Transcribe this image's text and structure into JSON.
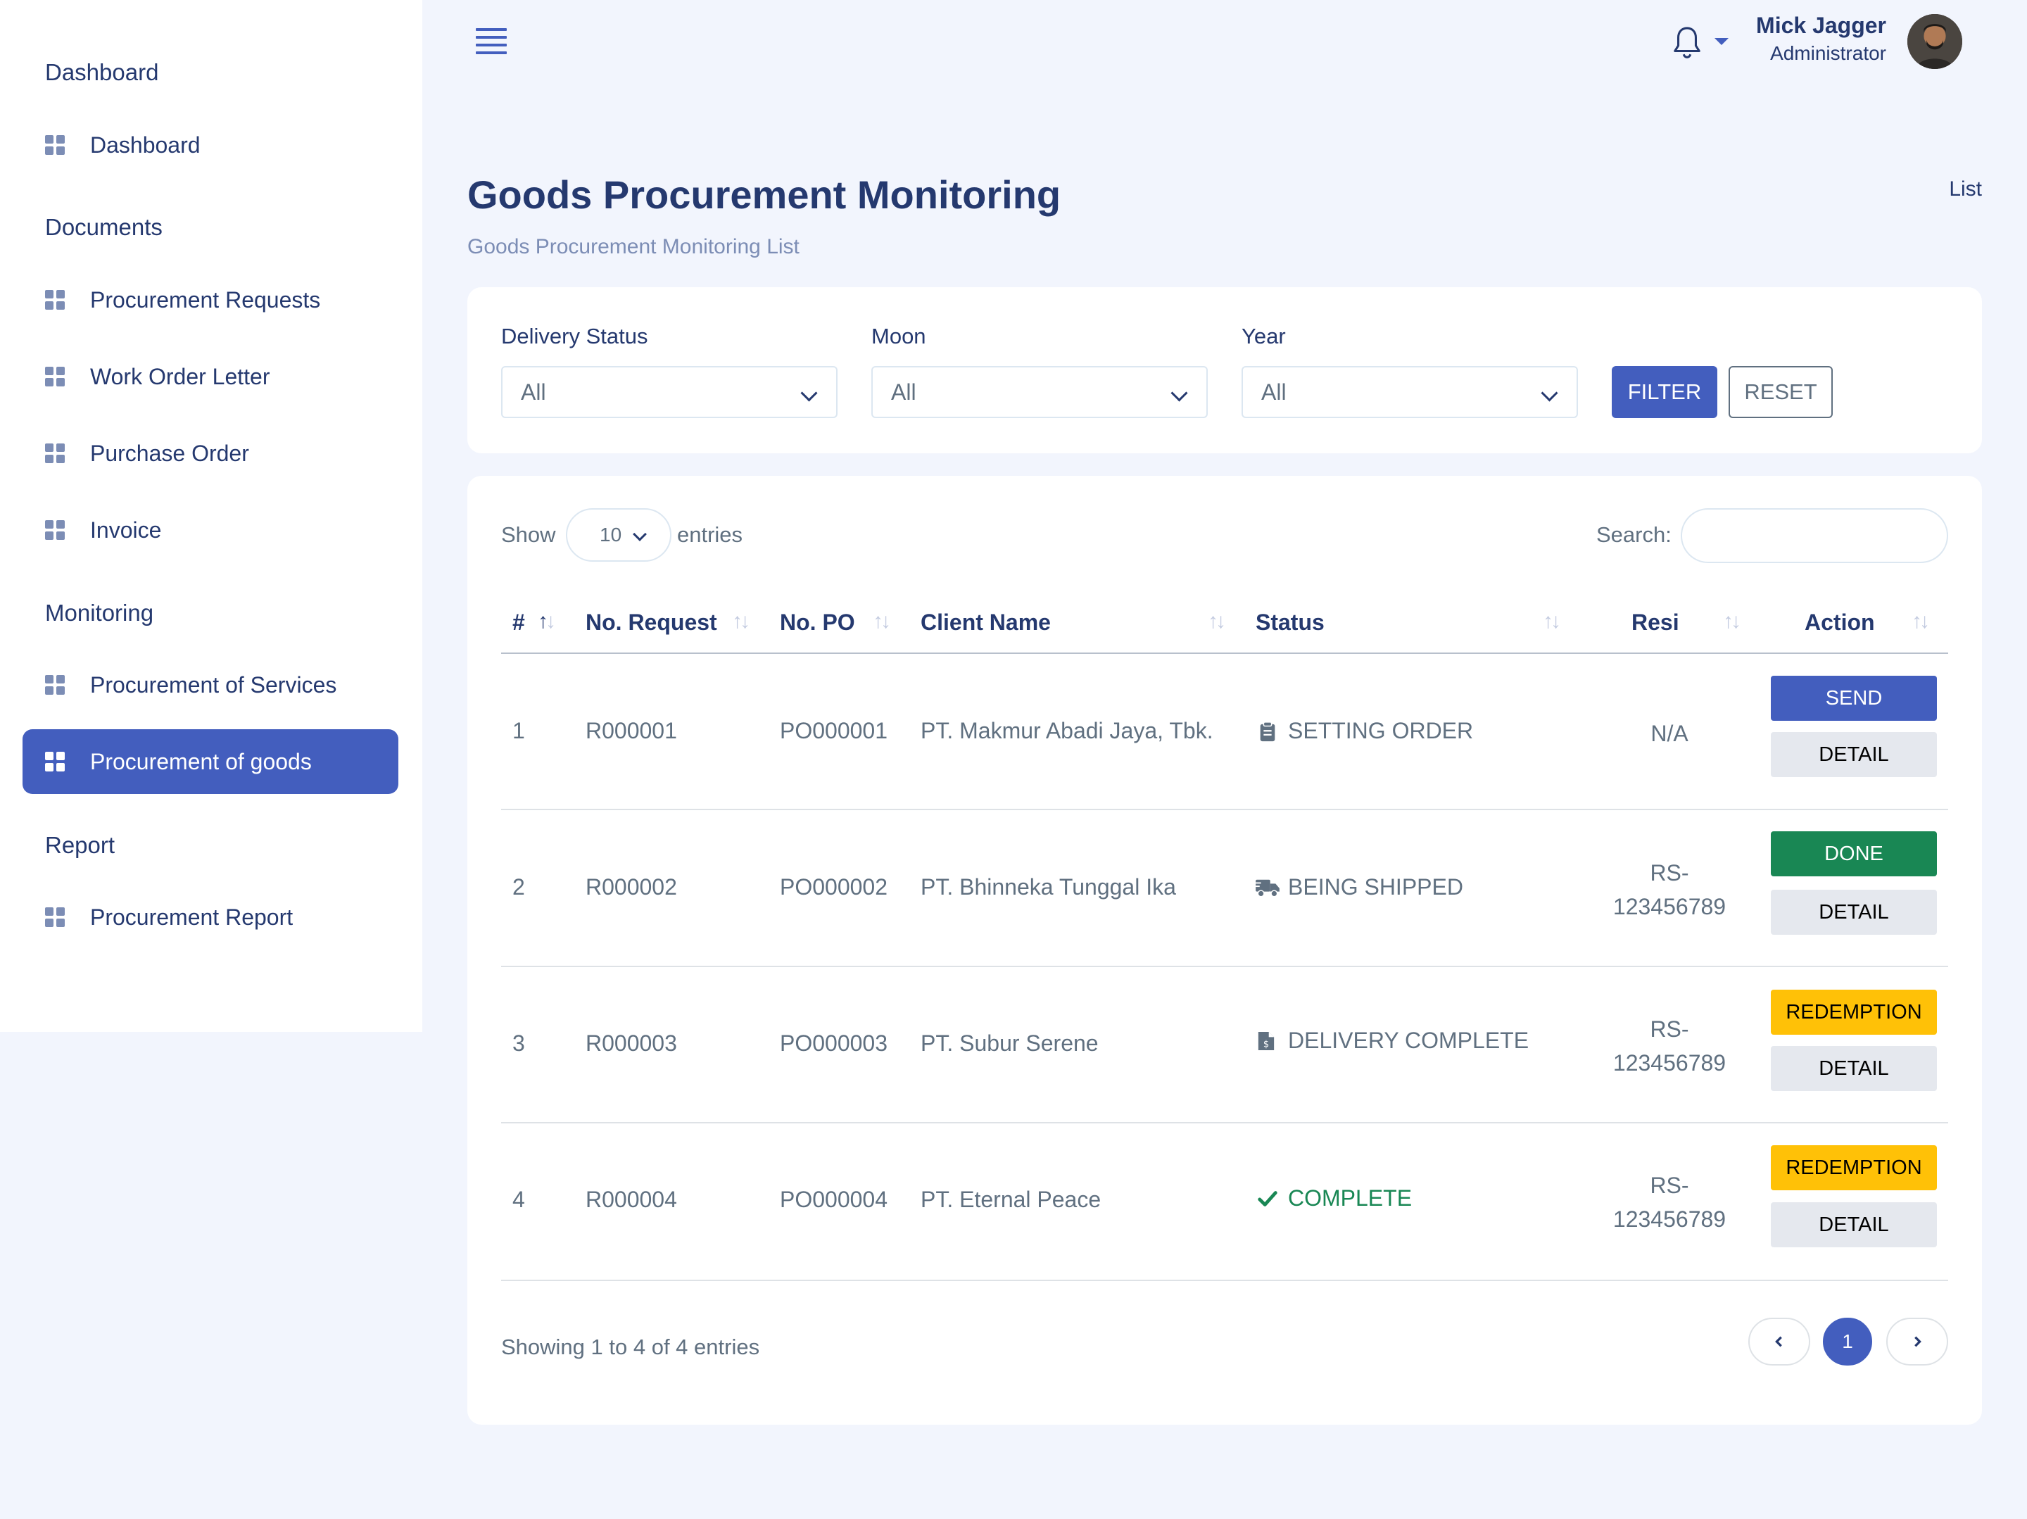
{
  "sidebar": {
    "sections": [
      {
        "title": "Dashboard",
        "items": [
          "Dashboard"
        ]
      },
      {
        "title": "Documents",
        "items": [
          "Procurement Requests",
          "Work Order Letter",
          "Purchase Order",
          "Invoice"
        ]
      },
      {
        "title": "Monitoring",
        "items": [
          "Procurement of Services",
          "Procurement of goods"
        ]
      },
      {
        "title": "Report",
        "items": [
          "Procurement Report"
        ]
      }
    ],
    "active_item": "Procurement of goods"
  },
  "header": {
    "user_name": "Mick Jagger",
    "user_role": "Administrator"
  },
  "page": {
    "title": "Goods Procurement Monitoring",
    "subtitle": "Goods Procurement Monitoring List",
    "breadcrumb": "List"
  },
  "filters": {
    "delivery_status": {
      "label": "Delivery Status",
      "value": "All"
    },
    "moon": {
      "label": "Moon",
      "value": "All"
    },
    "year": {
      "label": "Year",
      "value": "All"
    },
    "filter_button": "FILTER",
    "reset_button": "RESET"
  },
  "table": {
    "show_label": "Show",
    "entries_value": "10",
    "entries_label": "entries",
    "search_label": "Search:",
    "search_value": "",
    "columns": [
      "#",
      "No. Request",
      "No. PO",
      "Client Name",
      "Status",
      "Resi",
      "Action"
    ],
    "rows": [
      {
        "no": "1",
        "request": "R000001",
        "po": "PO000001",
        "client": "PT. Makmur Abadi Jaya, Tbk.",
        "status": "SETTING ORDER",
        "status_icon": "clipboard-icon",
        "resi": "N/A",
        "action": "SEND",
        "action_type": "send",
        "detail": "DETAIL"
      },
      {
        "no": "2",
        "request": "R000002",
        "po": "PO000002",
        "client": "PT. Bhinneka Tunggal Ika",
        "status": "BEING SHIPPED",
        "status_icon": "truck-icon",
        "resi": "RS-\n123456789",
        "action": "DONE",
        "action_type": "done",
        "detail": "DETAIL"
      },
      {
        "no": "3",
        "request": "R000003",
        "po": "PO000003",
        "client": "PT. Subur Serene",
        "status": "DELIVERY COMPLETE",
        "status_icon": "invoice-icon",
        "resi": "RS-\n123456789",
        "action": "REDEMPTION",
        "action_type": "redemption",
        "detail": "DETAIL"
      },
      {
        "no": "4",
        "request": "R000004",
        "po": "PO000004",
        "client": "PT. Eternal Peace",
        "status": "COMPLETE",
        "status_icon": "check-icon",
        "resi": "RS-\n123456789",
        "action": "REDEMPTION",
        "action_type": "redemption",
        "detail": "DETAIL"
      }
    ],
    "info": "Showing 1 to 4 of 4 entries",
    "pagination": {
      "current": "1"
    }
  },
  "colors": {
    "primary": "#435ebe",
    "success": "#198754",
    "warning": "#ffc107",
    "text": "#25396f"
  }
}
